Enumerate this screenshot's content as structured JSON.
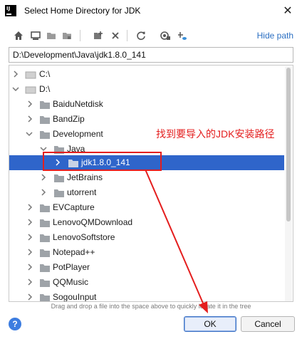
{
  "window": {
    "title": "Select Home Directory for JDK",
    "app_icon_text": "IJ",
    "close_glyph": "✕"
  },
  "toolbar": {
    "buttons": [
      "home-icon",
      "desktop-icon",
      "project-icon",
      "module-icon",
      "new-folder-icon",
      "delete-icon",
      "refresh-icon",
      "show-hidden-icon",
      "link-icon"
    ],
    "hide_path_label": "Hide path"
  },
  "path": {
    "value": "D:\\Development\\Java\\jdk1.8.0_141"
  },
  "tree": {
    "items": [
      {
        "label": "C:\\",
        "type": "drive",
        "expanded": false
      },
      {
        "label": "D:\\",
        "type": "drive",
        "expanded": true
      },
      {
        "label": "BaiduNetdisk",
        "type": "folder",
        "expanded": false
      },
      {
        "label": "BandZip",
        "type": "folder",
        "expanded": false
      },
      {
        "label": "Development",
        "type": "folder",
        "expanded": true
      },
      {
        "label": "Java",
        "type": "folder",
        "expanded": true
      },
      {
        "label": "jdk1.8.0_141",
        "type": "folder",
        "expanded": false,
        "selected": true
      },
      {
        "label": "JetBrains",
        "type": "folder",
        "expanded": false
      },
      {
        "label": "utorrent",
        "type": "folder",
        "expanded": false
      },
      {
        "label": "EVCapture",
        "type": "folder",
        "expanded": false
      },
      {
        "label": "LenovoQMDownload",
        "type": "folder",
        "expanded": false
      },
      {
        "label": "LenovoSoftstore",
        "type": "folder",
        "expanded": false
      },
      {
        "label": "Notepad++",
        "type": "folder",
        "expanded": false
      },
      {
        "label": "PotPlayer",
        "type": "folder",
        "expanded": false
      },
      {
        "label": "QQMusic",
        "type": "folder",
        "expanded": false
      },
      {
        "label": "SogouInput",
        "type": "folder",
        "expanded": false
      }
    ]
  },
  "hint": "Drag and drop a file into the space above to quickly locate it in the tree",
  "buttons": {
    "help": "?",
    "ok": "OK",
    "cancel": "Cancel"
  },
  "annotation": {
    "text": "找到要导入的JDK安装路径",
    "color": "#e41e1e"
  },
  "colors": {
    "selection": "#2f65ca",
    "link": "#2b6fc2"
  }
}
